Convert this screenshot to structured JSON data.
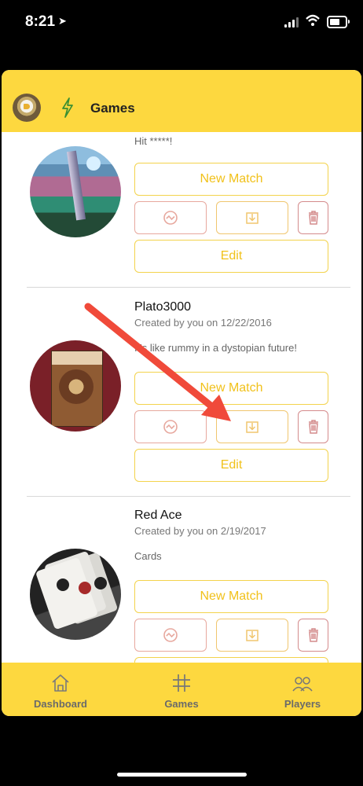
{
  "status_bar": {
    "time": "8:21"
  },
  "header": {
    "title": "Games",
    "avatar_icon": "eagle-avatar-icon",
    "bolt_icon": "lightning-bolt-icon"
  },
  "games": [
    {
      "description": "Hit *****!",
      "image": "mini-golf-photo",
      "new_match_label": "New Match",
      "edit_label": "Edit",
      "stats_icon": "chart-icon",
      "export_icon": "download-icon",
      "delete_icon": "trash-icon"
    },
    {
      "name": "Plato3000",
      "created": "Created by you on 12/22/2016",
      "description": "It's like rummy in a dystopian future!",
      "image": "plato3000-box-photo",
      "new_match_label": "New Match",
      "edit_label": "Edit",
      "stats_icon": "chart-icon",
      "export_icon": "download-icon",
      "delete_icon": "trash-icon"
    },
    {
      "name": "Red Ace",
      "created": "Created by you on 2/19/2017",
      "description": "Cards",
      "image": "playing-cards-photo",
      "new_match_label": "New Match",
      "stats_icon": "chart-icon",
      "export_icon": "download-icon",
      "delete_icon": "trash-icon"
    }
  ],
  "bottom_nav": {
    "items": [
      {
        "label": "Dashboard",
        "icon": "home-icon"
      },
      {
        "label": "Games",
        "icon": "hash-icon"
      },
      {
        "label": "Players",
        "icon": "people-icon"
      }
    ]
  },
  "colors": {
    "header": "#fdd83f",
    "primary_text": "#f1c11a",
    "button_border": "#f3d34c",
    "delete": "#d48b8c",
    "annotation_arrow": "#f04a3a"
  }
}
